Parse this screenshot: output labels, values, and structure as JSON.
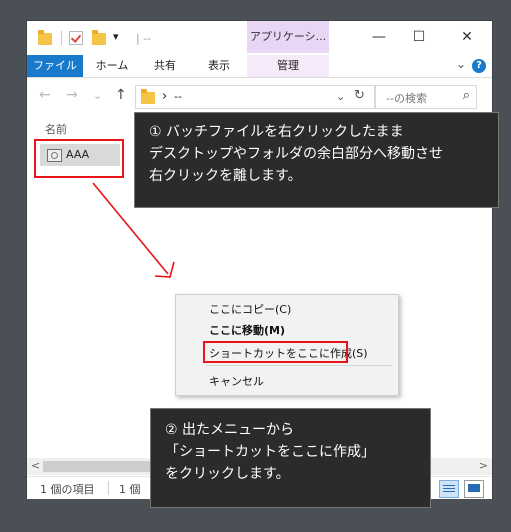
{
  "titlebar": {
    "qa_separator": "|",
    "qa_dropdown": "▾",
    "title": "| --",
    "context_tab_title": "アプリケーシ...",
    "minimize": "—",
    "maximize": "☐",
    "close": "✕"
  },
  "ribbon": {
    "tabs": [
      "ファイル",
      "ホーム",
      "共有",
      "表示",
      "管理"
    ],
    "collapse_chevron": "⌄",
    "help": "?"
  },
  "address": {
    "back": "←",
    "forward": "→",
    "recent": "⌄",
    "up": "↑",
    "path_chevron": "›",
    "path": "--",
    "dropdown": "⌄",
    "refresh": "↻",
    "search_placeholder": "--の検索",
    "search_icon": "⌕"
  },
  "content": {
    "column_name": "名前",
    "file_name": "AAA"
  },
  "status": {
    "item_count": "1 個の項目",
    "selected": "1 個",
    "scroll_left": "<",
    "scroll_right": ">"
  },
  "callout1": {
    "text": "① バッチファイルを右クリックしたまま\nデスクトップやフォルダの余白部分へ移動させ\n右クリックを離します。"
  },
  "context_menu": {
    "items": [
      "ここにコピー(C)",
      "ここに移動(M)",
      "ショートカットをここに作成(S)",
      "キャンセル"
    ]
  },
  "callout2": {
    "text": "② 出たメニューから\n「ショートカットをここに作成」\nをクリックします。"
  },
  "colors": {
    "accent": "#1979ca",
    "highlight_red": "#e8141a",
    "callout_bg": "#2b2b2b",
    "context_tab": "#e9d5f4"
  }
}
